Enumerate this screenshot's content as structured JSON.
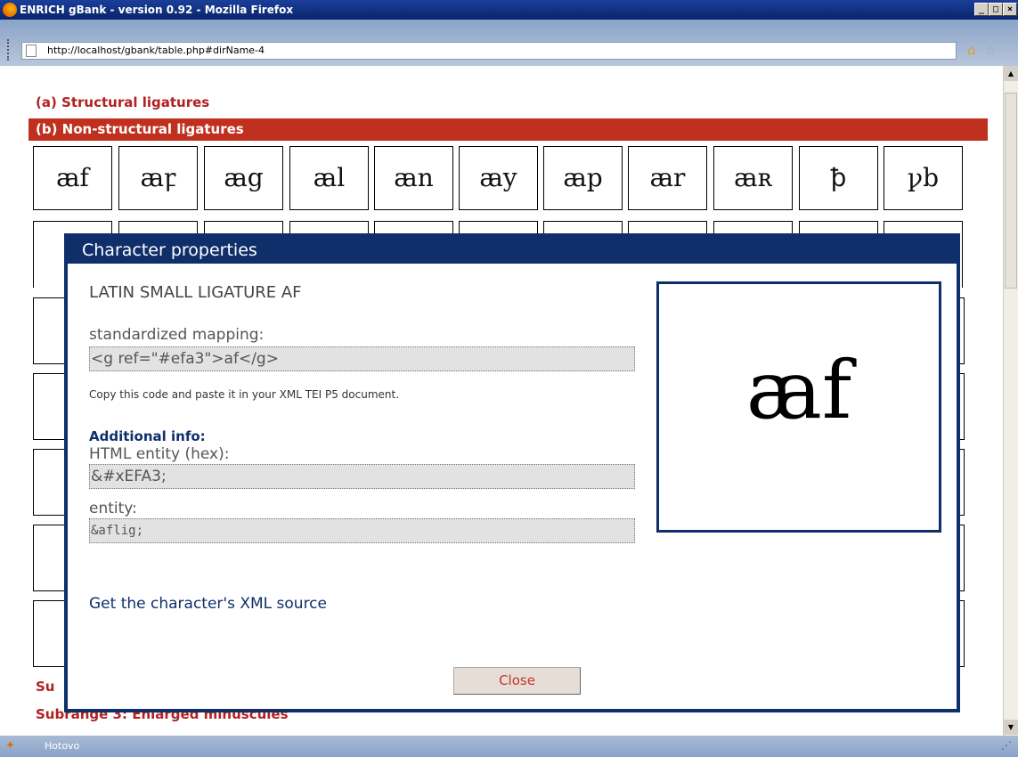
{
  "window": {
    "title": "ENRICH gBank - version 0.92 - Mozilla Firefox",
    "min_label": "_",
    "max_label": "□",
    "close_label": "×"
  },
  "address": {
    "url": "http://localhost/gbank/table.php#dirName-4"
  },
  "icons": {
    "home": "⌂",
    "star": "☆"
  },
  "page": {
    "section_a": "(a) Structural ligatures",
    "section_b": "(b) Non-structural ligatures",
    "glyphs": [
      "ꜳf",
      "ꜳꝼ",
      "ꜳg",
      "ꜳl",
      "ꜳn",
      "ꜳy",
      "ꜳp",
      "ꜳr",
      "ꜳʀ",
      "ꝥ",
      "ꝩb"
    ],
    "subrange_partial": "Su",
    "subrange_3": "Subrange 3: Enlarged minuscules"
  },
  "modal": {
    "title": "Character properties",
    "char_name": "LATIN SMALL LIGATURE AF",
    "std_mapping_label": "standardized mapping:",
    "std_mapping_value": "<g ref=\"#efa3\">af</g>",
    "copy_note": "Copy this code and paste it in your XML TEI P5 document.",
    "additional_label": "Additional info:",
    "html_entity_label": "HTML entity (hex):",
    "html_entity_value": "&#xEFA3;",
    "entity_label": "entity:",
    "entity_value": "&aflig;",
    "xml_link": "Get the character's XML source",
    "preview_glyph": "ꜳf",
    "close_label": "Close"
  },
  "status": {
    "text": "Hotovo"
  },
  "colors": {
    "accent_red": "#c0301e",
    "modal_blue": "#0f2f6b"
  }
}
